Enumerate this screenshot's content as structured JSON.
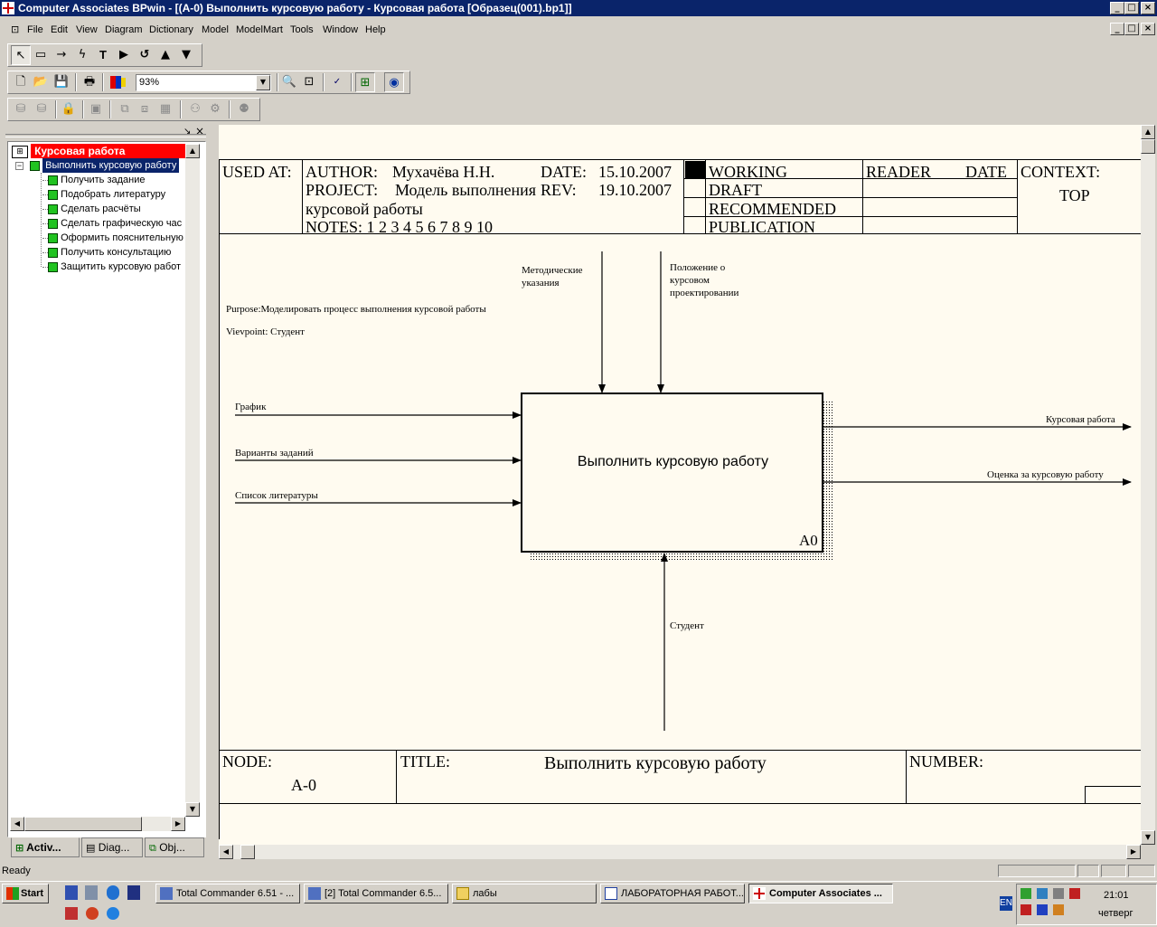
{
  "window": {
    "title": "Computer Associates BPwin - [(A-0) Выполнить курсовую работу - Курсовая работа  [Образец(001).bp1]]"
  },
  "menu": [
    "File",
    "Edit",
    "View",
    "Diagram",
    "Dictionary",
    "Model",
    "ModelMart",
    "Tools",
    "Window",
    "Help"
  ],
  "toolbar": {
    "zoom": "93%"
  },
  "tree": {
    "root": "Курсовая работа",
    "selected": "Выполнить курсовую работу",
    "children": [
      "Получить  задание",
      "Подобрать литературу",
      "Сделать расчёты",
      "Сделать графическую час",
      "Оформить пояснительную",
      "Получить консультацию",
      "Защитить курсовую работ"
    ]
  },
  "tabs": [
    "Activ...",
    "Diag...",
    "Obj..."
  ],
  "diagram": {
    "header": {
      "used_at": "USED AT:",
      "author_label": "AUTHOR:",
      "author": "Мухачёва Н.Н.",
      "date_label": "DATE:",
      "date": "15.10.2007",
      "project_label": "PROJECT:",
      "project": "Модель выполнения",
      "project2": "курсовой работы",
      "rev_label": "REV:",
      "rev": "19.10.2007",
      "notes": "NOTES:  1  2  3  4  5  6  7  8  9  10",
      "status": [
        "WORKING",
        "DRAFT",
        "RECOMMENDED",
        "PUBLICATION"
      ],
      "reader": "READER",
      "reader_date": "DATE",
      "context_label": "CONTEXT:",
      "context": "TOP"
    },
    "purpose": "Purpose:Моделировать процесс выполнения курсовой работы",
    "viewpoint": "Vievpoint: Студент",
    "box_title": "Выполнить курсовую работу",
    "box_number": "A0",
    "controls": [
      "Методические\nуказания",
      "Положение о\nкурсовом\nпроектировании"
    ],
    "inputs": [
      "График",
      "Варианты заданий",
      "Список литературы"
    ],
    "outputs": [
      "Курсовая работа",
      "Оценка за курсовую работу"
    ],
    "mechanism": "Студент",
    "footer": {
      "node_label": "NODE:",
      "node": "A-0",
      "title_label": "TITLE:",
      "title": "Выполнить курсовую работу",
      "number_label": "NUMBER:"
    }
  },
  "status": "Ready",
  "taskbar": {
    "start": "Start",
    "tasks": [
      "Total Commander 6.51 - ...",
      "[2] Total Commander 6.5...",
      "лабы",
      "ЛАБОРАТОРНАЯ РАБОТ...",
      "Computer Associates ..."
    ],
    "lang": "EN",
    "time": "21:01",
    "day": "четверг"
  },
  "colors": {
    "titlebar": "#0a246a",
    "tree_root_bg": "#ff0000",
    "tree_selected_bg": "#0a246a",
    "box_square": "#21c321",
    "canvas": "#fffbf0"
  }
}
